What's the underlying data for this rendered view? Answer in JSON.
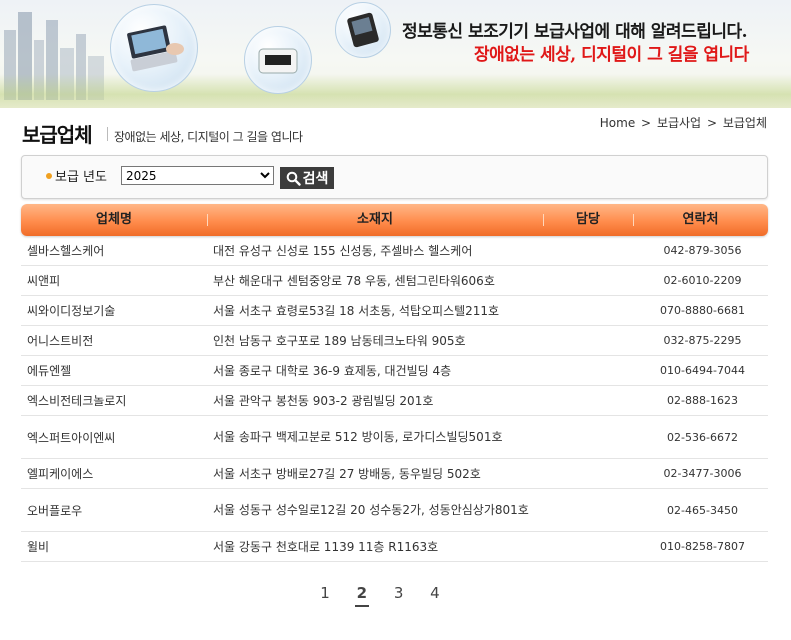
{
  "banner": {
    "line1": "정보통신 보조기기 보급사업에 대해 알려드립니다.",
    "line2": "장애없는 세상, 디지털이 그 길을 엽니다"
  },
  "header": {
    "title": "보급업체",
    "subtitle": "장애없는 세상, 디지털이 그 길을 엽니다",
    "breadcrumb": [
      "Home",
      "보급사업",
      "보급업체"
    ]
  },
  "search": {
    "year_label": "보급 년도",
    "year_selected": "2025",
    "button_label": "검색"
  },
  "table": {
    "columns": [
      "업체명",
      "소재지",
      "담당",
      "연락처"
    ],
    "rows": [
      {
        "name": "셀바스헬스케어",
        "address": "대전 유성구 신성로 155  신성동, 주셀바스 헬스케어",
        "manager": "",
        "phone": "042-879-3056"
      },
      {
        "name": "씨앤피",
        "address": "부산 해운대구 센텀중앙로 78  우동, 센텀그린타워606호",
        "manager": "",
        "phone": "02-6010-2209"
      },
      {
        "name": "씨와이디정보기술",
        "address": "서울 서초구 효령로53길 18  서초동, 석탑오피스텔211호",
        "manager": "",
        "phone": "070-8880-6681"
      },
      {
        "name": "어니스트비전",
        "address": "인천 남동구 호구포로 189  남동테크노타워 905호",
        "manager": "",
        "phone": "032-875-2295"
      },
      {
        "name": "에듀엔젤",
        "address": "서울 종로구 대학로 36-9  효제동, 대건빌딩 4층",
        "manager": "",
        "phone": "010-6494-7044"
      },
      {
        "name": "엑스비전테크놀로지",
        "address": "서울 관악구 봉천동  903-2 광림빌딩 201호",
        "manager": "",
        "phone": "02-888-1623"
      },
      {
        "name": "엑스퍼트아이엔씨",
        "address": "서울 송파구 백제고분로 512  방이동, 로가디스빌딩501호",
        "manager": "",
        "phone": "02-536-6672"
      },
      {
        "name": "엘피케이에스",
        "address": "서울 서초구 방배로27길 27  방배동, 동우빌딩 502호",
        "manager": "",
        "phone": "02-3477-3006"
      },
      {
        "name": "오버플로우",
        "address": "서울 성동구 성수일로12길 20  성수동2가, 성동안심상가801호",
        "manager": "",
        "phone": "02-465-3450"
      },
      {
        "name": "윌비",
        "address": "서울 강동구 천호대로 1139  11층 R1163호",
        "manager": "",
        "phone": "010-8258-7807"
      }
    ]
  },
  "pagination": {
    "pages": [
      "1",
      "2",
      "3",
      "4"
    ],
    "current": "2"
  },
  "colors": {
    "header_orange": "#ff8c4c",
    "banner_red": "#e01818",
    "bullet": "#f0a020"
  },
  "icons": {
    "search_button": "magnifier-icon"
  }
}
